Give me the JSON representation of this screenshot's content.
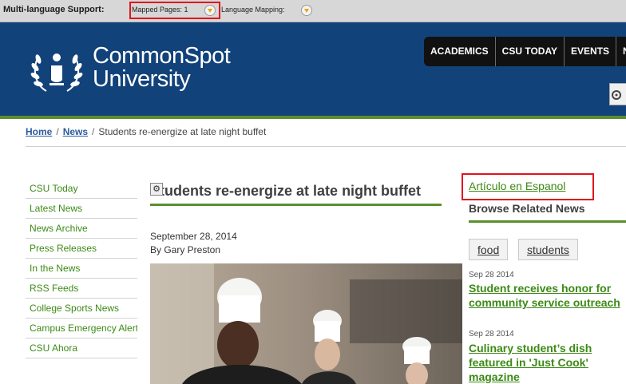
{
  "ml_bar": {
    "title": "Multi-language Support:",
    "mapped_pages": "Mapped Pages: 1",
    "language_mapping": "Language Mapping:"
  },
  "header": {
    "logo_line1": "CommonSpot",
    "logo_line2": "University",
    "nav": [
      "ACADEMICS",
      "CSU TODAY",
      "EVENTS",
      "NE"
    ]
  },
  "breadcrumb": {
    "home": "Home",
    "sep": "/",
    "news": "News",
    "current": "Students re-energize at late night buffet"
  },
  "sidebar": {
    "items": [
      "CSU Today",
      "Latest News",
      "News Archive",
      "Press Releases",
      "In the News",
      "RSS Feeds",
      "College Sports News",
      "Campus Emergency Alerts",
      "CSU Ahora"
    ]
  },
  "article": {
    "title": "Students re-energize at late night buffet",
    "date": "September 28, 2014",
    "byline": "By Gary Preston"
  },
  "right": {
    "spanish_link": "Artículo en Espanol",
    "related_title": "Browse Related News",
    "tags": [
      "food",
      "students"
    ],
    "news": [
      {
        "date": "Sep 28 2014",
        "title": "Student receives honor for community service outreach"
      },
      {
        "date": "Sep 28 2014",
        "title": "Culinary student’s dish featured in 'Just Cook' magazine"
      }
    ]
  },
  "colors": {
    "header_blue": "#12427a",
    "accent_green": "#5a8f2d",
    "link_green": "#3c8a16",
    "highlight_red": "#e0141e"
  }
}
